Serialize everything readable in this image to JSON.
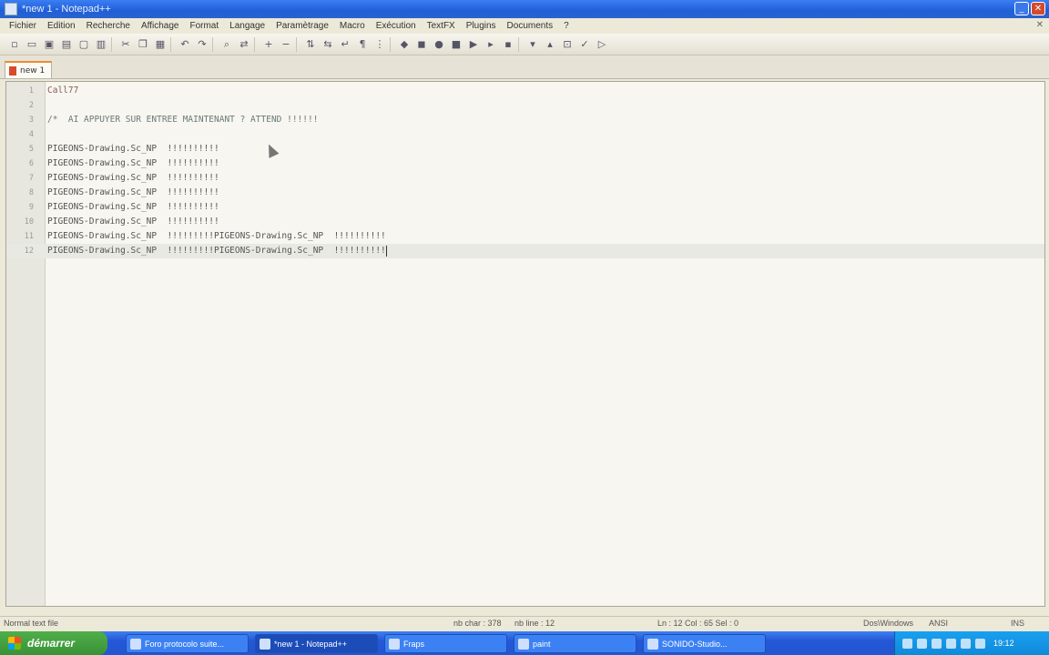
{
  "window": {
    "title": "*new 1 - Notepad++"
  },
  "menu": [
    "Fichier",
    "Edition",
    "Recherche",
    "Affichage",
    "Format",
    "Langage",
    "Paramètrage",
    "Macro",
    "Exécution",
    "TextFX",
    "Plugins",
    "Documents",
    "?"
  ],
  "tab": {
    "label": "new 1"
  },
  "editor": {
    "lines": [
      {
        "num": "1",
        "text": "Call77",
        "style": "dot"
      },
      {
        "num": "2",
        "text": ""
      },
      {
        "num": "3",
        "text": "/*  AI APPUYER SUR ENTREE MAINTENANT ? ATTEND !!!!!!",
        "style": "comment"
      },
      {
        "num": "4",
        "text": ""
      },
      {
        "num": "5",
        "text": "PIGEONS-Drawing.Sc_NP  !!!!!!!!!!"
      },
      {
        "num": "6",
        "text": "PIGEONS-Drawing.Sc_NP  !!!!!!!!!!"
      },
      {
        "num": "7",
        "text": "PIGEONS-Drawing.Sc_NP  !!!!!!!!!!"
      },
      {
        "num": "8",
        "text": "PIGEONS-Drawing.Sc_NP  !!!!!!!!!!"
      },
      {
        "num": "9",
        "text": "PIGEONS-Drawing.Sc_NP  !!!!!!!!!!"
      },
      {
        "num": "10",
        "text": "PIGEONS-Drawing.Sc_NP  !!!!!!!!!!"
      },
      {
        "num": "11",
        "text": "PIGEONS-Drawing.Sc_NP  !!!!!!!!!PIGEONS-Drawing.Sc_NP  !!!!!!!!!!"
      },
      {
        "num": "12",
        "text": "PIGEONS-Drawing.Sc_NP  !!!!!!!!!PIGEONS-Drawing.Sc_NP  !!!!!!!!!!",
        "current": true
      }
    ]
  },
  "status": {
    "type": "Normal text file",
    "length": "nb char : 378",
    "lines": "nb line : 12",
    "position": "Ln : 12   Col : 65   Sel : 0",
    "eol": "Dos\\Windows",
    "encoding": "ANSI",
    "mode": "INS"
  },
  "taskbar": {
    "start": "démarrer",
    "tasks": [
      {
        "label": "Foro protocolo suite..."
      },
      {
        "label": "*new 1 - Notepad++",
        "active": true
      },
      {
        "label": "Fraps"
      },
      {
        "label": "paint"
      },
      {
        "label": "SONIDO-Studio..."
      }
    ],
    "clock": "19:12"
  }
}
